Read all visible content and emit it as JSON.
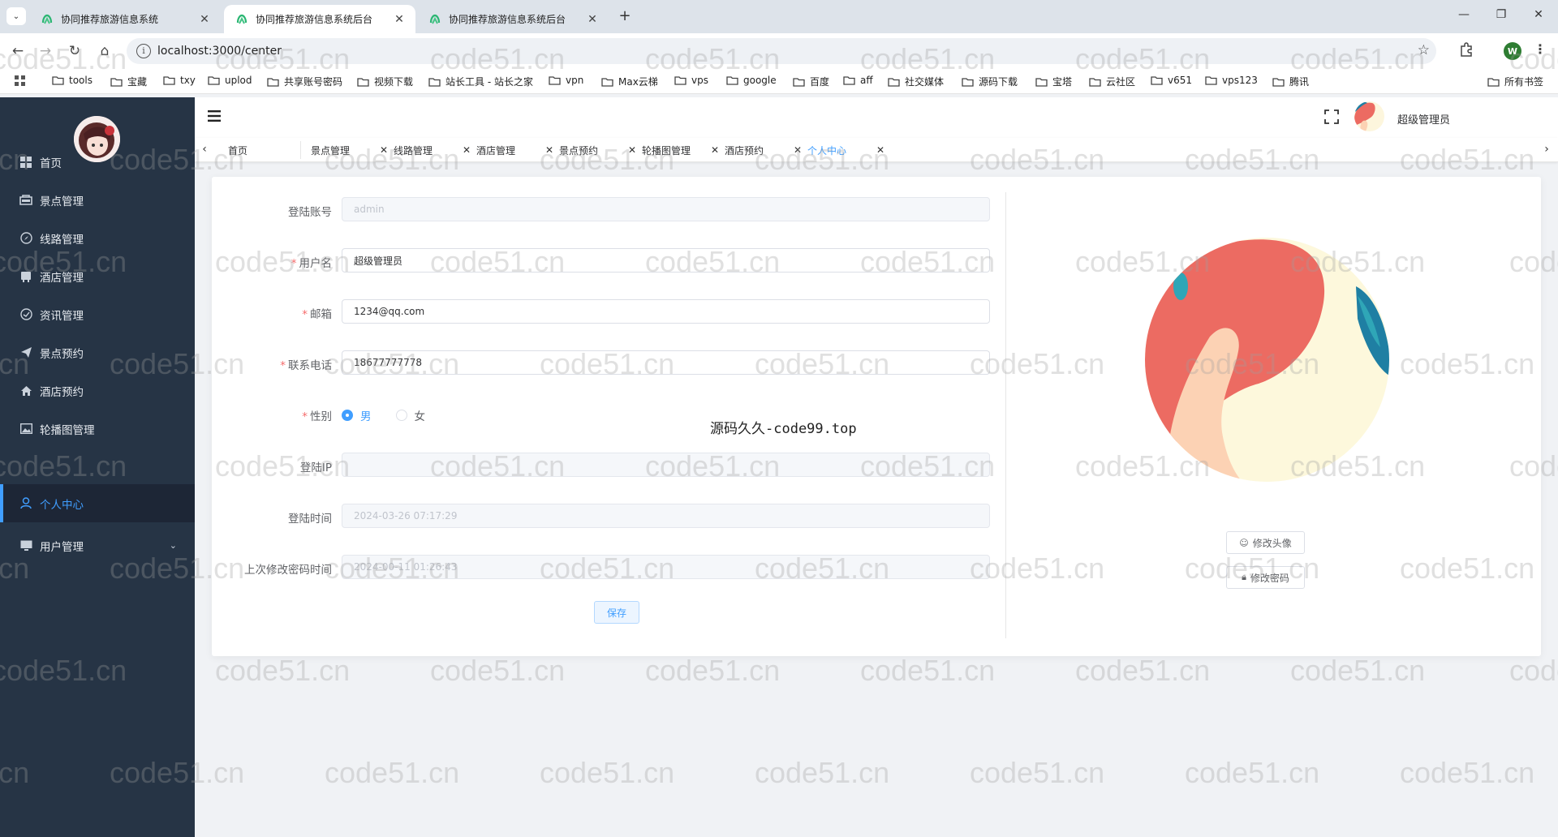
{
  "browser": {
    "tabs": [
      {
        "title": "协同推荐旅游信息系统"
      },
      {
        "title": "协同推荐旅游信息系统后台"
      },
      {
        "title": "协同推荐旅游信息系统后台"
      }
    ],
    "url": "localhost:3000/center",
    "profile_letter": "W",
    "bookmarks": [
      "tools",
      "宝藏",
      "txy",
      "uplod",
      "共享账号密码",
      "视频下载",
      "站长工具 - 站长之家",
      "vpn",
      "Max云梯",
      "vps",
      "google",
      "百度",
      "aff",
      "社交媒体",
      "源码下载",
      "宝塔",
      "云社区",
      "v651",
      "vps123",
      "腾讯"
    ],
    "all_bookmarks": "所有书签"
  },
  "sidebar": {
    "items": [
      {
        "label": "首页",
        "icon": "dashboard-icon"
      },
      {
        "label": "景点管理",
        "icon": "scenic-icon"
      },
      {
        "label": "线路管理",
        "icon": "compass-icon"
      },
      {
        "label": "酒店管理",
        "icon": "hotel-icon"
      },
      {
        "label": "资讯管理",
        "icon": "news-icon"
      },
      {
        "label": "景点预约",
        "icon": "send-icon"
      },
      {
        "label": "酒店预约",
        "icon": "home-icon"
      },
      {
        "label": "轮播图管理",
        "icon": "picture-icon"
      },
      {
        "label": "个人中心",
        "icon": "user-icon"
      },
      {
        "label": "用户管理",
        "icon": "monitor-icon"
      }
    ]
  },
  "navbar": {
    "username": "超级管理员"
  },
  "tags": [
    "首页",
    "景点管理",
    "线路管理",
    "酒店管理",
    "景点预约",
    "轮播图管理",
    "酒店预约",
    "个人中心"
  ],
  "form": {
    "account_label": "登陆账号",
    "account_value": "admin",
    "username_label": "用户名",
    "username_value": "超级管理员",
    "email_label": "邮箱",
    "email_value": "1234@qq.com",
    "phone_label": "联系电话",
    "phone_value": "18677777778",
    "gender_label": "性别",
    "gender_male": "男",
    "gender_female": "女",
    "ip_label": "登陆IP",
    "ip_value": "",
    "login_time_label": "登陆时间",
    "login_time_value": "2024-03-26 07:17:29",
    "pwd_time_label": "上次修改密码时间",
    "pwd_time_value": "2024-00-11 01:26:43",
    "save_label": "保存"
  },
  "profile_panel": {
    "change_avatar": "修改头像",
    "change_password": "修改密码"
  },
  "overlay": "源码久久-code99.top",
  "watermark": "code51.cn",
  "colors": {
    "sidebar_bg": "#263445",
    "accent": "#409eff",
    "required": "#f56c6c"
  }
}
